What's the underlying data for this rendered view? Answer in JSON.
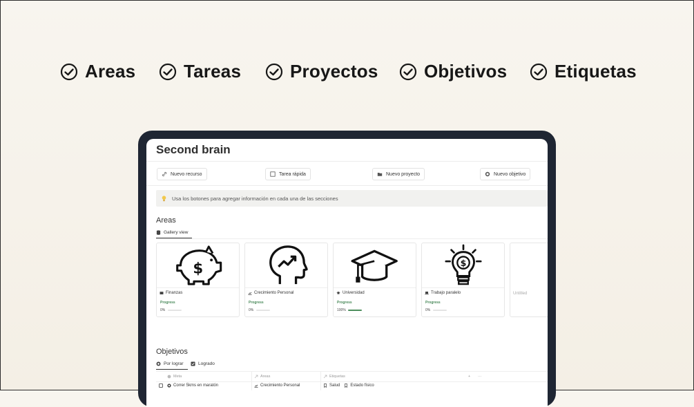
{
  "features": [
    {
      "label": "Areas",
      "icon": "check-circle-icon"
    },
    {
      "label": "Tareas",
      "icon": "check-circle-icon"
    },
    {
      "label": "Proyectos",
      "icon": "check-circle-icon"
    },
    {
      "label": "Objetivos",
      "icon": "check-circle-icon"
    },
    {
      "label": "Etiquetas",
      "icon": "check-circle-icon"
    }
  ],
  "page": {
    "title": "Second brain"
  },
  "quick_buttons": [
    {
      "label": "Nuevo recurso",
      "icon": "link-icon"
    },
    {
      "label": "Tarea rápida",
      "icon": "checkbox-icon"
    },
    {
      "label": "Nuevo proyecto",
      "icon": "folder-icon"
    },
    {
      "label": "Nuevo objetivo",
      "icon": "target-icon"
    }
  ],
  "callout": {
    "text": "Usa los botones para agregar información en cada una de las secciones",
    "icon": "lightbulb-icon"
  },
  "areas": {
    "title": "Areas",
    "view": "Gallery view",
    "progress_label": "Progress",
    "cards": [
      {
        "name": "Finanzas",
        "progress_text": "0%",
        "progress": 0,
        "cover": "piggy-bank-icon"
      },
      {
        "name": "Crecimiento Personal",
        "progress_text": "0%",
        "progress": 0,
        "cover": "head-growth-icon"
      },
      {
        "name": "Universidad",
        "progress_text": "100%",
        "progress": 1,
        "cover": "graduation-cap-icon"
      },
      {
        "name": "Trabajo paralelo",
        "progress_text": "0%",
        "progress": 0,
        "cover": "idea-bulb-icon"
      },
      {
        "name": "Untitled"
      }
    ]
  },
  "objetivos": {
    "title": "Objetivos",
    "tabs": [
      "Por lograr",
      "Logrado"
    ],
    "columns": [
      "Meta",
      "Areas",
      "Etiquetas"
    ],
    "header_actions": [
      "+",
      "···"
    ],
    "rows": [
      {
        "meta": "Correr 5kms en maratón",
        "area": "Crecimiento Personal",
        "tags": [
          "Salud",
          "Estado físico"
        ]
      }
    ]
  },
  "colors": {
    "accent_green": "#4d8e5d",
    "device_frame": "#1f2633",
    "callout_bg": "#f1f1ef"
  }
}
